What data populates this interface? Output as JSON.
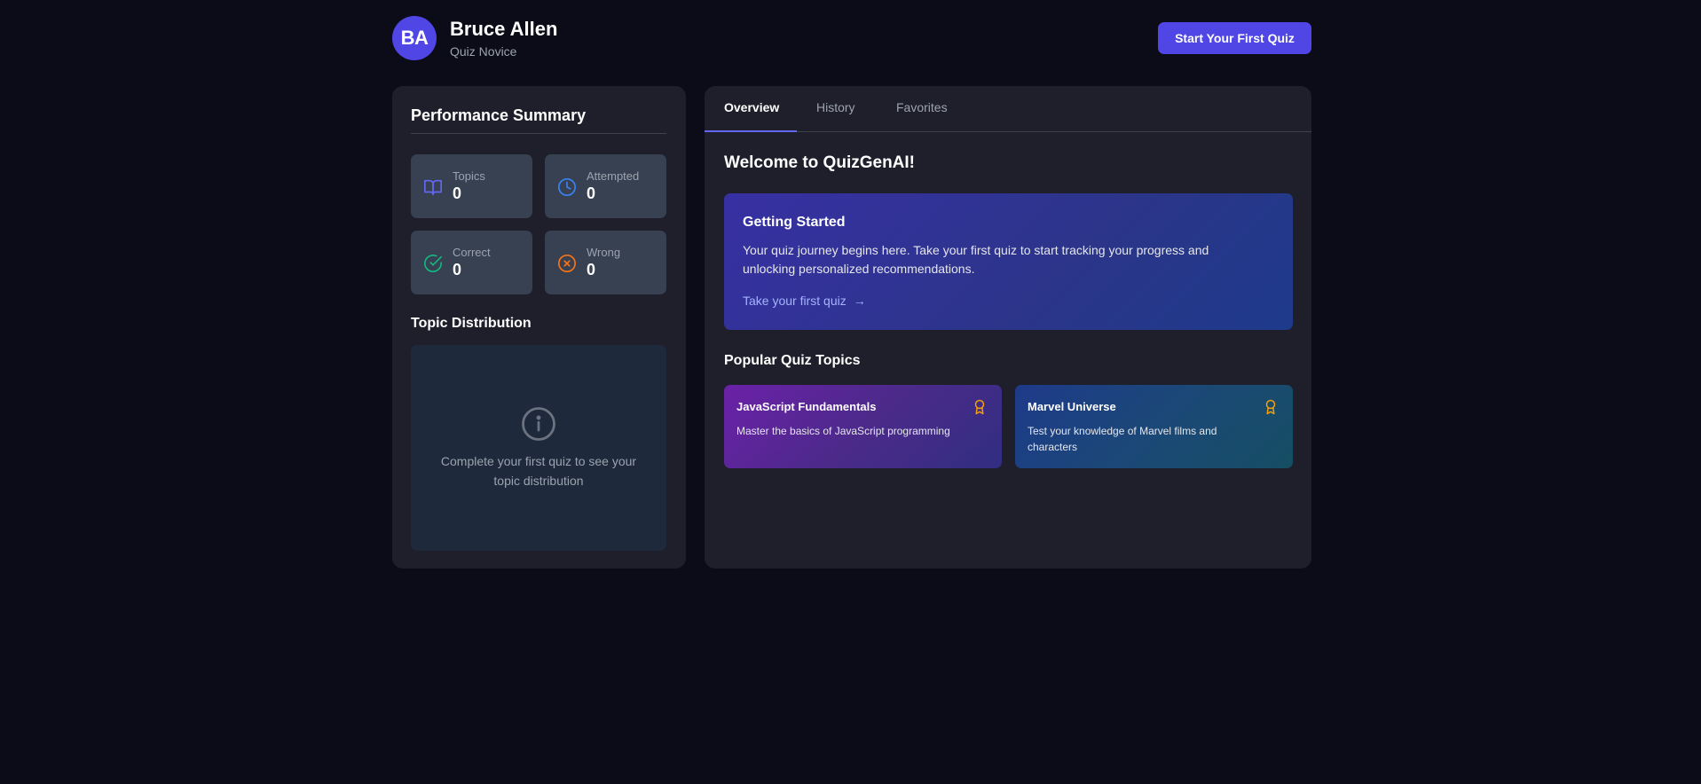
{
  "user": {
    "initials": "BA",
    "name": "Bruce Allen",
    "rank": "Quiz Novice"
  },
  "header": {
    "start_button": "Start Your First Quiz"
  },
  "performance": {
    "title": "Performance Summary",
    "stats": [
      {
        "label": "Topics",
        "value": "0",
        "icon": "book-icon",
        "color": "#6366f1"
      },
      {
        "label": "Attempted",
        "value": "0",
        "icon": "clock-icon",
        "color": "#3b82f6"
      },
      {
        "label": "Correct",
        "value": "0",
        "icon": "check-circle-icon",
        "color": "#10b981"
      },
      {
        "label": "Wrong",
        "value": "0",
        "icon": "x-circle-icon",
        "color": "#f97316"
      }
    ]
  },
  "distribution": {
    "title": "Topic Distribution",
    "empty_message": "Complete your first quiz to see your topic distribution"
  },
  "tabs": [
    "Overview",
    "History",
    "Favorites"
  ],
  "active_tab": "Overview",
  "overview": {
    "welcome": "Welcome to QuizGenAI!",
    "getting_started": {
      "title": "Getting Started",
      "text": "Your quiz journey begins here. Take your first quiz to start tracking your progress and unlocking personalized recommendations.",
      "link": "Take your first quiz"
    },
    "popular_title": "Popular Quiz Topics",
    "topics": [
      {
        "title": "JavaScript Fundamentals",
        "description": "Master the basics of JavaScript programming"
      },
      {
        "title": "Marvel Universe",
        "description": "Test your knowledge of Marvel films and characters"
      }
    ]
  },
  "colors": {
    "background": "#0b0c17",
    "card": "#1f1f2b",
    "accent": "#4f46e5",
    "award": "#f59e0b"
  }
}
